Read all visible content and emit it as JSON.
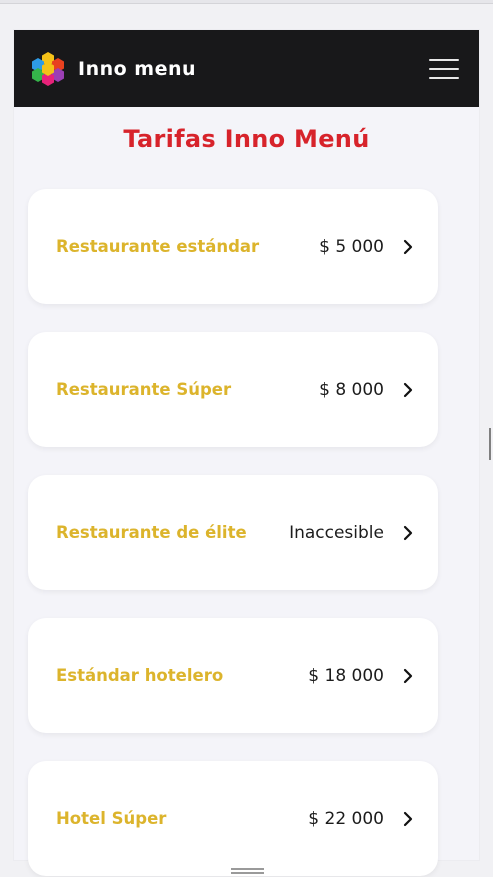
{
  "app": {
    "brand_name": "Inno menu"
  },
  "page": {
    "title": "Tarifas Inno Menú"
  },
  "plans": [
    {
      "name": "Restaurante estándar",
      "price": "$ 5 000"
    },
    {
      "name": "Restaurante Súper",
      "price": "$ 8 000"
    },
    {
      "name": "Restaurante de élite",
      "price": "Inaccesible"
    },
    {
      "name": "Estándar hotelero",
      "price": "$ 18 000"
    },
    {
      "name": "Hotel Súper",
      "price": "$ 22 000"
    }
  ],
  "icons": {
    "menu": "hamburger-icon",
    "chevron": "chevron-right-icon",
    "logo": "hexagon-cluster-logo"
  },
  "colors": {
    "title": "#d7232b",
    "plan_name": "#dcb42c",
    "navbar": "#18181a",
    "background": "#f4f4f9"
  }
}
